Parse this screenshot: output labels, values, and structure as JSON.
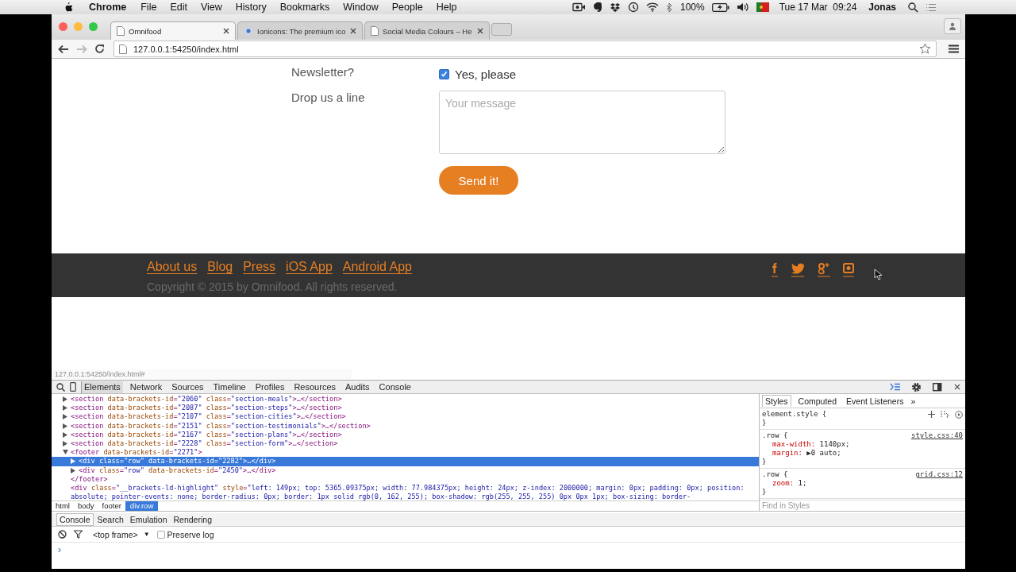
{
  "menubar": {
    "app": "Chrome",
    "menus": [
      "File",
      "Edit",
      "View",
      "History",
      "Bookmarks",
      "Window",
      "People",
      "Help"
    ],
    "battery": "100%",
    "clock": "Tue 17 Mar  09:24",
    "user": "Jonas"
  },
  "tabs": [
    {
      "title": "Omnifood",
      "kind": "page",
      "selected": true
    },
    {
      "title": "Ionicons: The premium ico",
      "kind": "loading",
      "selected": false
    },
    {
      "title": "Social Media Colours – He",
      "kind": "page",
      "selected": false
    }
  ],
  "address": {
    "url": "127.0.0.1:54250/index.html"
  },
  "form": {
    "rows": [
      {
        "kind": "checkbox",
        "label": "Newsletter?",
        "option": "Yes, please",
        "checked": true
      },
      {
        "kind": "textarea",
        "label": "Drop us a line",
        "placeholder": "Your message"
      }
    ],
    "submit": "Send it!"
  },
  "footer": {
    "links": [
      "About us",
      "Blog",
      "Press",
      "iOS App",
      "Android App"
    ],
    "copyright": "Copyright © 2015 by Omnifood. All rights reserved."
  },
  "status_url": "127.0.0.1:54250/index.html#",
  "devtools": {
    "tabs": [
      {
        "label": "Elements",
        "selected": true
      },
      {
        "label": "Network",
        "selected": false
      },
      {
        "label": "Sources",
        "selected": false
      },
      {
        "label": "Timeline",
        "selected": false
      },
      {
        "label": "Profiles",
        "selected": false
      },
      {
        "label": "Resources",
        "selected": false
      },
      {
        "label": "Audits",
        "selected": false
      },
      {
        "label": "Console",
        "selected": false
      }
    ],
    "dom": [
      {
        "code": "<section data-brackets-id=\"2060\" class=\"section-meals\">…</section>",
        "expandable": true,
        "expanded": false,
        "selected": false
      },
      {
        "code": "<section data-brackets-id=\"2087\" class=\"section-steps\">…</section>",
        "expandable": true,
        "expanded": false,
        "selected": false
      },
      {
        "code": "<section data-brackets-id=\"2107\" class=\"section-cities\">…</section>",
        "expandable": true,
        "expanded": false,
        "selected": false
      },
      {
        "code": "<section data-brackets-id=\"2151\" class=\"section-testimonials\">…</section>",
        "expandable": true,
        "expanded": false,
        "selected": false
      },
      {
        "code": "<section data-brackets-id=\"2167\" class=\"section-plans\">…</section>",
        "expandable": true,
        "expanded": false,
        "selected": false
      },
      {
        "code": "<section data-brackets-id=\"2228\" class=\"section-form\">…</section>",
        "expandable": true,
        "expanded": false,
        "selected": false
      },
      {
        "code": "<footer data-brackets-id=\"2271\">",
        "expandable": true,
        "expanded": true,
        "selected": false,
        "close": "</footer>",
        "children": [
          {
            "code": "<div class=\"row\" data-brackets-id=\"2282\">…</div>",
            "expandable": true,
            "expanded": false,
            "selected": true
          },
          {
            "code": "<div class=\"row\" data-brackets-id=\"2450\">…</div>",
            "expandable": true,
            "expanded": false,
            "selected": false
          }
        ]
      },
      {
        "code": "<div class=\"__brackets-ld-highlight\" style=\"left: 149px; top: 5365.09375px; width: 77.984375px; height: 24px; z-index: 2000000; margin: 0px; padding: 0px; position: absolute; pointer-events: none; border-radius: 0px; border: 1px solid rgb(0, 162, 255); box-shadow: rgb(255, 255, 255) 0px 0px 1px; box-sizing: border-",
        "expandable": false,
        "selected": false
      }
    ],
    "breadcrumb": [
      {
        "label": "html",
        "selected": false
      },
      {
        "label": "body",
        "selected": false
      },
      {
        "label": "footer",
        "selected": false
      },
      {
        "label": "div.row",
        "selected": true
      }
    ],
    "sidebar_tabs": [
      {
        "label": "Styles",
        "selected": true
      },
      {
        "label": "Computed",
        "selected": false
      },
      {
        "label": "Event Listeners",
        "selected": false
      }
    ],
    "sidebar_more": "»",
    "rules": [
      {
        "selector": "element.style {",
        "close": "}"
      },
      {
        "selector": ".row {",
        "source": "style.css:40",
        "properties": [
          {
            "name": "max-width:",
            "value": "1140px;"
          },
          {
            "name": "margin:",
            "value": "▶0 auto;"
          }
        ],
        "close": "}"
      },
      {
        "selector": ".row {",
        "source": "grid.css:12",
        "properties": [
          {
            "name": "zoom:",
            "value": "1;"
          }
        ],
        "close": "}"
      }
    ],
    "find_placeholder": "Find in Styles"
  },
  "drawer": {
    "tabs": [
      {
        "label": "Console",
        "selected": true
      },
      {
        "label": "Search",
        "selected": false
      },
      {
        "label": "Emulation",
        "selected": false
      },
      {
        "label": "Rendering",
        "selected": false
      }
    ],
    "frame": "<top frame>",
    "frame_caret": "▼",
    "preserve_log": {
      "label": "Preserve log",
      "checked": false
    },
    "prompt": "›"
  }
}
